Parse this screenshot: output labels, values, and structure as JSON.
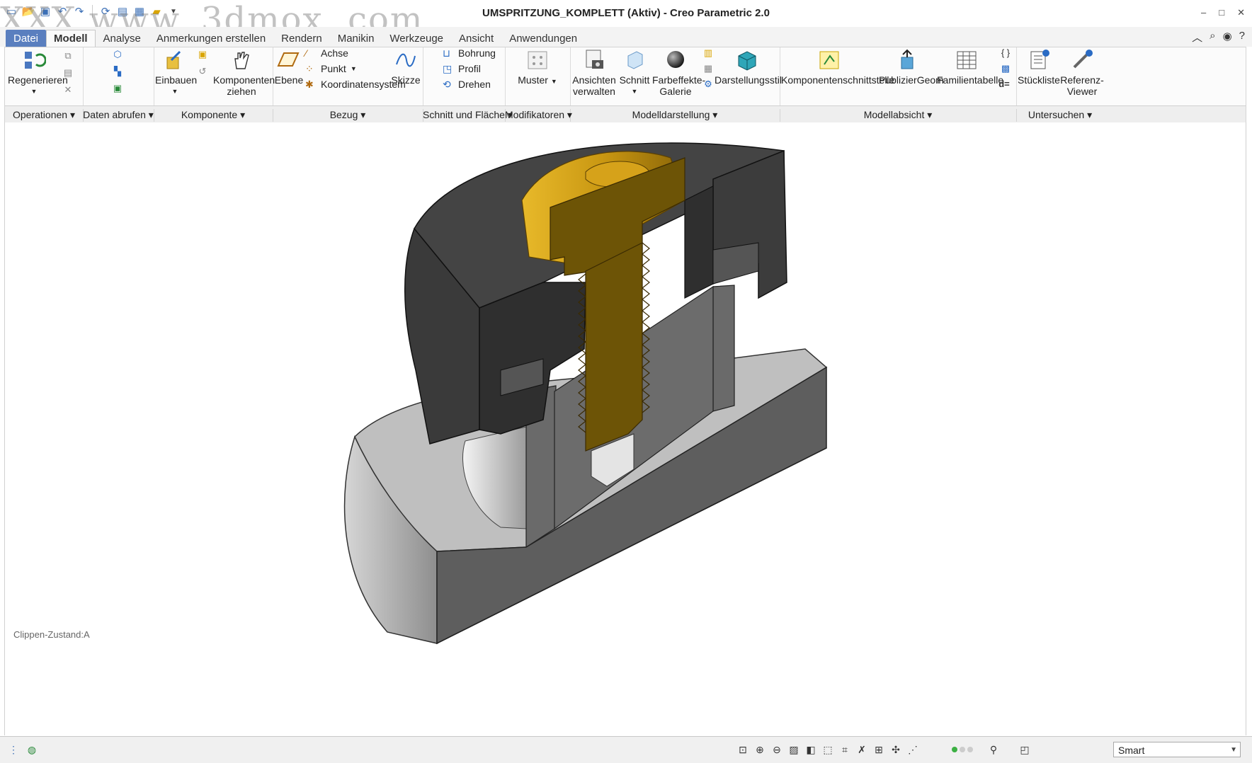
{
  "window": {
    "title": "UMSPRITZUNG_KOMPLETT (Aktiv) - Creo Parametric 2.0",
    "watermark": "XXX www. 3dmox. com",
    "controls": [
      "–",
      "□",
      "✕"
    ]
  },
  "tabs": [
    {
      "label": "Datei"
    },
    {
      "label": "Modell"
    },
    {
      "label": "Analyse"
    },
    {
      "label": "Anmerkungen erstellen"
    },
    {
      "label": "Rendern"
    },
    {
      "label": "Manikin"
    },
    {
      "label": "Werkzeuge"
    },
    {
      "label": "Ansicht"
    },
    {
      "label": "Anwendungen"
    }
  ],
  "active_tab": "Modell",
  "ribbon": {
    "regenerieren": "Regenerieren",
    "einbauen": "Einbauen",
    "komponenten_ziehen": "Komponenten ziehen",
    "ebene": "Ebene",
    "achse": "Achse",
    "punkt": "Punkt",
    "koordinatensystem": "Koordinatensystem",
    "skizze": "Skizze",
    "bohrung": "Bohrung",
    "profil": "Profil",
    "drehen": "Drehen",
    "muster": "Muster",
    "ansichten_verwalten": "Ansichten verwalten",
    "schnitt": "Schnitt",
    "farbeffekte_galerie": "Farbeffekte-Galerie",
    "darstellungsstil": "Darstellungsstil",
    "komponentenschnittstelle": "Komponentenschnittstelle",
    "publiziergeom": "PublizierGeom",
    "familientabelle": "Familientabelle",
    "stueckliste": "Stückliste",
    "referenz_viewer": "Referenz-Viewer",
    "d_equals": "d="
  },
  "groups": [
    {
      "label": "Operationen"
    },
    {
      "label": "Daten abrufen"
    },
    {
      "label": "Komponente"
    },
    {
      "label": "Bezug"
    },
    {
      "label": "Schnitt und Fläche"
    },
    {
      "label": "Modifikatoren"
    },
    {
      "label": "Modelldarstellung"
    },
    {
      "label": "Modellabsicht"
    },
    {
      "label": "Untersuchen"
    }
  ],
  "graphics": {
    "clip_state": "Clippen-Zustand:A"
  },
  "status": {
    "filter": "Smart"
  },
  "colors": {
    "accent": "#3b6fb6",
    "brass": "#b08a12",
    "dark_part": "#3d3d3d",
    "light_part": "#bdbdbd"
  }
}
